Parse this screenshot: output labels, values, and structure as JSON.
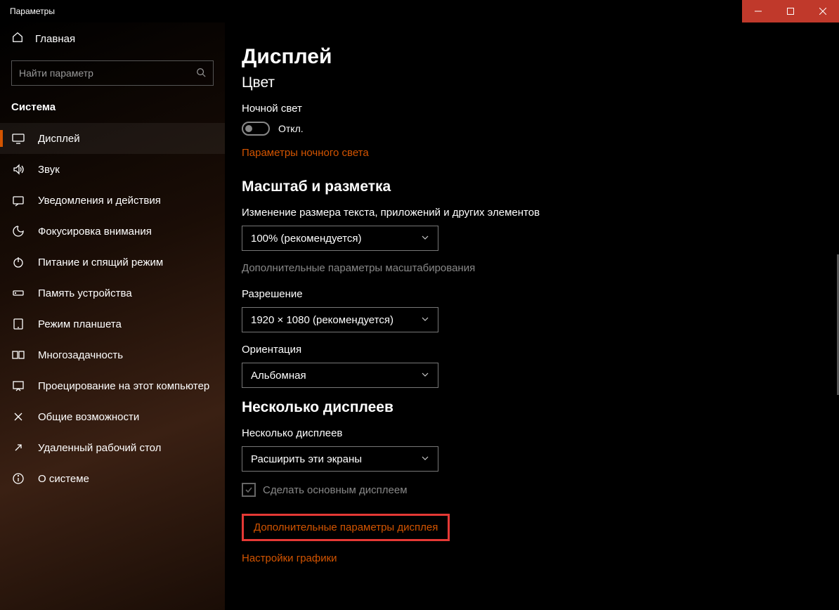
{
  "window": {
    "title": "Параметры"
  },
  "sidebar": {
    "home": "Главная",
    "searchPlaceholder": "Найти параметр",
    "category": "Система",
    "items": [
      {
        "label": "Дисплей",
        "active": true
      },
      {
        "label": "Звук"
      },
      {
        "label": "Уведомления и действия"
      },
      {
        "label": "Фокусировка внимания"
      },
      {
        "label": "Питание и спящий режим"
      },
      {
        "label": "Память устройства"
      },
      {
        "label": "Режим планшета"
      },
      {
        "label": "Многозадачность"
      },
      {
        "label": "Проецирование на этот компьютер"
      },
      {
        "label": "Общие возможности"
      },
      {
        "label": "Удаленный рабочий стол"
      },
      {
        "label": "О системе"
      }
    ]
  },
  "main": {
    "title": "Дисплей",
    "colorSection": {
      "heading": "Цвет",
      "nightLightLabel": "Ночной свет",
      "nightLightState": "Откл.",
      "nightLightLink": "Параметры ночного света"
    },
    "scaleSection": {
      "heading": "Масштаб и разметка",
      "scaleLabel": "Изменение размера текста, приложений и других элементов",
      "scaleValue": "100% (рекомендуется)",
      "advancedScaleLink": "Дополнительные параметры масштабирования",
      "resolutionLabel": "Разрешение",
      "resolutionValue": "1920 × 1080 (рекомендуется)",
      "orientationLabel": "Ориентация",
      "orientationValue": "Альбомная"
    },
    "multiSection": {
      "heading": "Несколько дисплеев",
      "multiLabel": "Несколько дисплеев",
      "multiValue": "Расширить эти экраны",
      "makePrimaryLabel": "Сделать основным дисплеем",
      "advancedDisplayLink": "Дополнительные параметры дисплея",
      "graphicsLink": "Настройки графики"
    }
  }
}
